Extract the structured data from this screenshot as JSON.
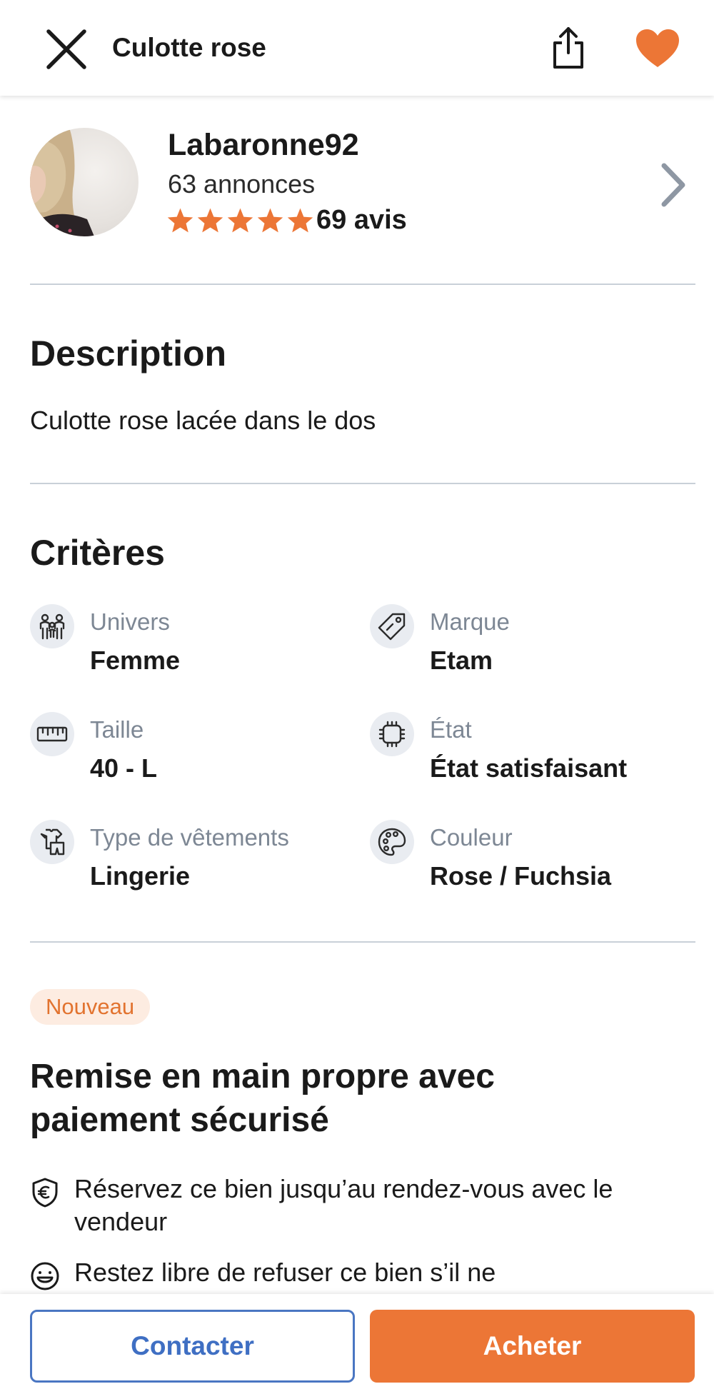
{
  "header": {
    "title": "Culotte rose",
    "icons": {
      "close": "close-icon",
      "share": "share-icon",
      "favorite": "heart-icon"
    },
    "accent_color": "#ec7636"
  },
  "seller": {
    "name": "Labaronne92",
    "listings": "63 annonces",
    "rating": 5,
    "rating_max": 5,
    "reviews": "69 avis"
  },
  "description": {
    "heading": "Description",
    "text": "Culotte rose lacée dans le dos"
  },
  "criteria": {
    "heading": "Critères",
    "items": [
      {
        "label": "Univers",
        "value": "Femme",
        "icon": "people-icon"
      },
      {
        "label": "Marque",
        "value": "Etam",
        "icon": "tag-icon"
      },
      {
        "label": "Taille",
        "value": "40 - L",
        "icon": "ruler-icon"
      },
      {
        "label": "État",
        "value": "État satisfaisant",
        "icon": "condition-icon"
      },
      {
        "label": "Type de vêtements",
        "value": "Lingerie",
        "icon": "clothes-icon"
      },
      {
        "label": "Couleur",
        "value": "Rose / Fuchsia",
        "icon": "palette-icon"
      }
    ]
  },
  "remise": {
    "badge": "Nouveau",
    "title": "Remise en main propre avec paiement sécurisé",
    "bullets": [
      {
        "icon": "shield-euro-icon",
        "text": "Réservez ce bien jusqu’au rendez-vous avec le vendeur"
      },
      {
        "icon": "smiley-icon",
        "text": "Restez libre de refuser ce bien s’il ne"
      }
    ]
  },
  "actions": {
    "contact": "Contacter",
    "buy": "Acheter"
  }
}
